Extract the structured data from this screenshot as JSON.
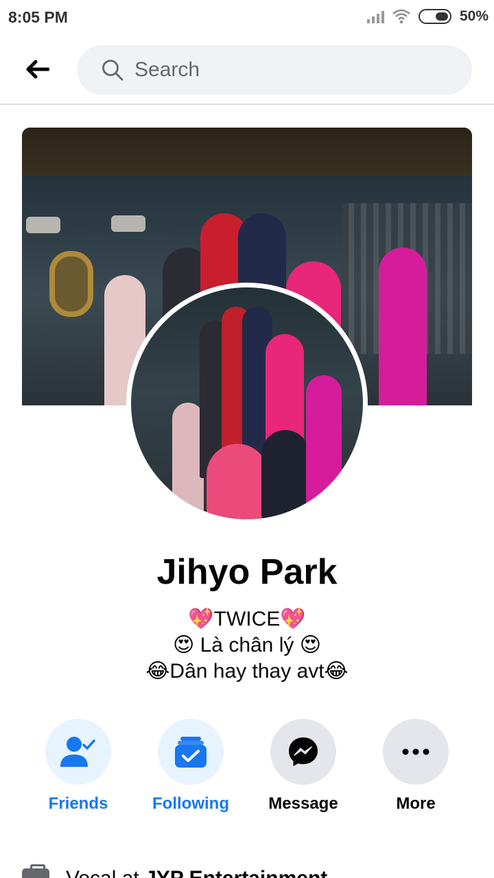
{
  "status_bar": {
    "time": "8:05 PM",
    "battery_percent": "50%"
  },
  "header": {
    "back_icon": "arrow-left-icon",
    "search_placeholder": "Search"
  },
  "profile": {
    "name": "Jihyo Park",
    "bio_lines": [
      "💖TWICE💖",
      "😍 Là chân lý 😍",
      "😂Dân hay thay avt😂"
    ]
  },
  "actions": [
    {
      "label": "Friends",
      "icon": "friends-check-icon",
      "color": "#1877f2"
    },
    {
      "label": "Following",
      "icon": "following-check-icon",
      "color": "#1877f2"
    },
    {
      "label": "Message",
      "icon": "messenger-icon",
      "color": "#050505"
    },
    {
      "label": "More",
      "icon": "more-dots-icon",
      "color": "#050505"
    }
  ],
  "intro": {
    "work_prefix": "Vocal at ",
    "work_org": "JYP Entertainment"
  },
  "colors": {
    "accent": "#1877f2",
    "accent_bg": "#e7f3ff",
    "grey_bg": "#e4e6eb",
    "search_bg": "#f0f2f5"
  }
}
